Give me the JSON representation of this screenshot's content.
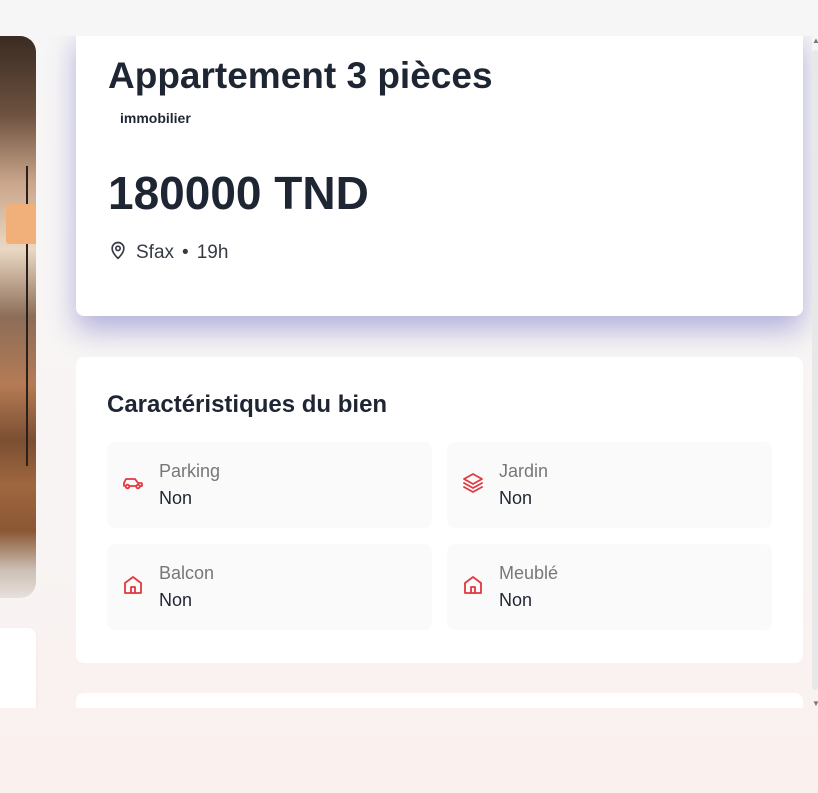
{
  "listing": {
    "title": "Appartement 3 pièces",
    "category": "immobilier",
    "price": "180000 TND",
    "location": "Sfax",
    "separator": "•",
    "posted": "19h"
  },
  "features": {
    "title": "Caractéristiques du bien",
    "items": [
      {
        "label": "Parking",
        "value": "Non",
        "icon": "car-icon"
      },
      {
        "label": "Jardin",
        "value": "Non",
        "icon": "layers-icon"
      },
      {
        "label": "Balcon",
        "value": "Non",
        "icon": "home-icon"
      },
      {
        "label": "Meublé",
        "value": "Non",
        "icon": "home-icon"
      }
    ]
  },
  "colors": {
    "accent": "#e0393e",
    "text": "#1f2633",
    "muted": "#777777"
  },
  "icons": {
    "expand": "expand-icon",
    "location": "map-pin-icon"
  }
}
